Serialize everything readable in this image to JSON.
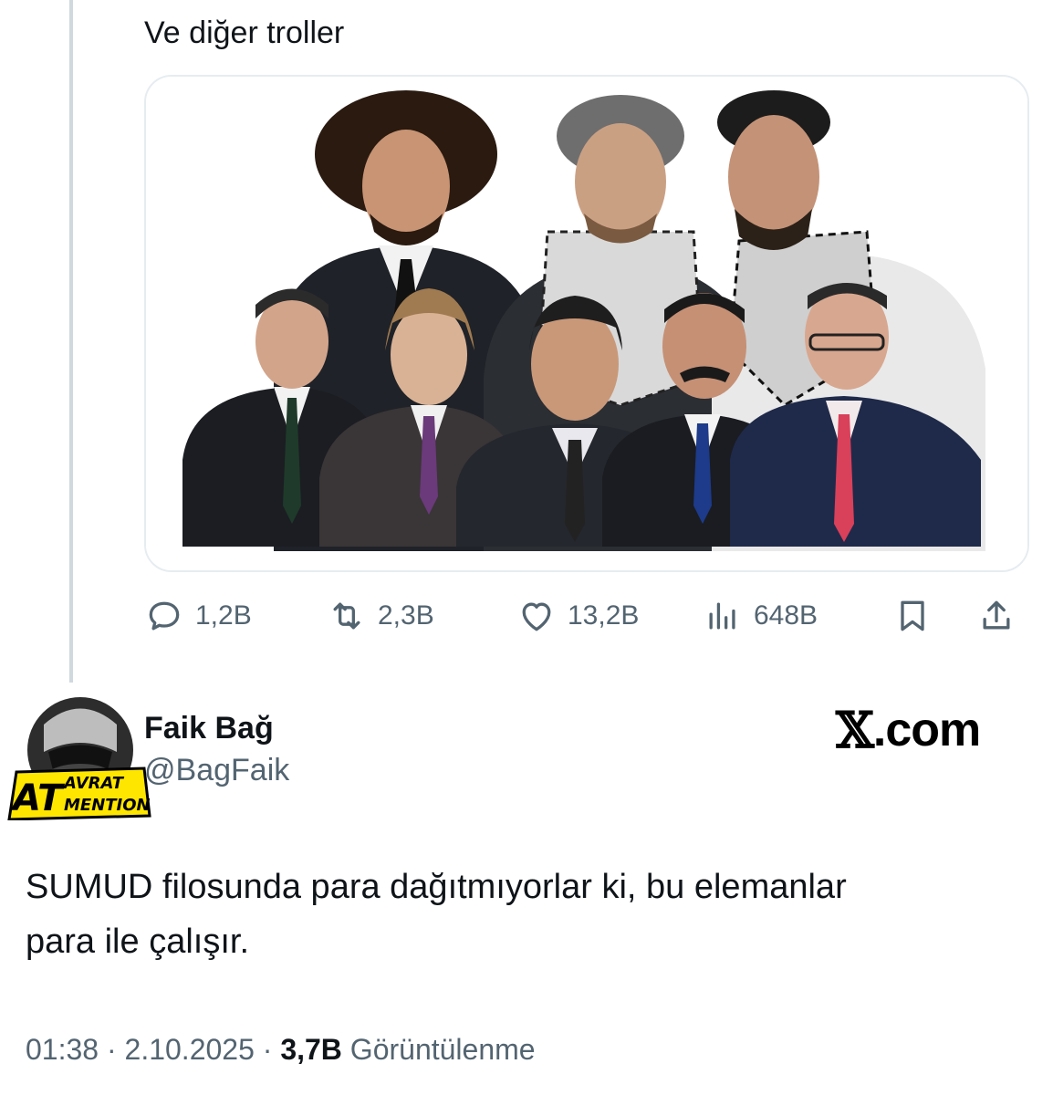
{
  "quoted": {
    "text": "Ve diğer troller",
    "media_alt": "group of men",
    "stats": {
      "replies": "1,2B",
      "retweets": "2,3B",
      "likes": "13,2B",
      "views": "648B"
    }
  },
  "author": {
    "name": "Faik Bağ",
    "handle": "@BagFaik",
    "avatar_badge_big": "AT",
    "avatar_badge_top": "AVRAT",
    "avatar_badge_bottom": "MENTION"
  },
  "brand": {
    "glyph": "𝕏",
    "label": ".com"
  },
  "tweet": {
    "text_line1": "SUMUD filosunda para dağıtmıyorlar ki, bu elemanlar",
    "text_line2": "para ile çalışır.",
    "time": "01:38",
    "separator": "·",
    "date": "2.10.2025",
    "views_count": "3,7B",
    "views_label": "Görüntülenme"
  },
  "icons": [
    "reply-icon",
    "retweet-icon",
    "like-icon",
    "views-icon",
    "bookmark-icon",
    "share-icon"
  ],
  "colors": {
    "text": "#0f1419",
    "secondary": "#536471",
    "thread_line": "#cfd9de",
    "card_border": "#e6ecf0",
    "badge_yellow": "#ffe600"
  }
}
